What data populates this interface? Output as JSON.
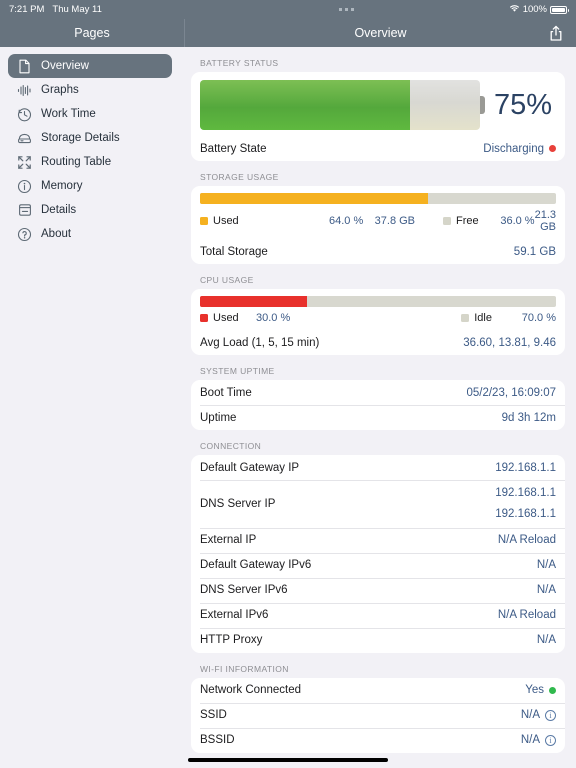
{
  "status_bar": {
    "time": "7:21 PM",
    "date": "Thu May 11",
    "wifi_icon": "wifi-icon",
    "battery_percent": "100%",
    "multitask_handle": "multitasking-handle-icon"
  },
  "nav": {
    "sidebar_title": "Pages",
    "main_title": "Overview",
    "share_icon": "share-icon"
  },
  "sidebar": {
    "items": [
      {
        "label": "Overview",
        "icon": "document-icon",
        "selected": true
      },
      {
        "label": "Graphs",
        "icon": "waveform-icon",
        "selected": false
      },
      {
        "label": "Work Time",
        "icon": "clock-arrow-icon",
        "selected": false
      },
      {
        "label": "Storage Details",
        "icon": "drive-icon",
        "selected": false
      },
      {
        "label": "Routing Table",
        "icon": "arrows-expand-icon",
        "selected": false
      },
      {
        "label": "Memory",
        "icon": "info-circle-icon",
        "selected": false
      },
      {
        "label": "Details",
        "icon": "list-box-icon",
        "selected": false
      },
      {
        "label": "About",
        "icon": "question-circle-icon",
        "selected": false
      }
    ]
  },
  "battery_status": {
    "header": "BATTERY STATUS",
    "percent_label": "75%",
    "percent_value": 75,
    "fill_color": "#54a83c",
    "state_label": "Battery State",
    "state_value": "Discharging",
    "state_dot_color": "#e8403a"
  },
  "storage_usage": {
    "header": "STORAGE USAGE",
    "used_pct_value": 64,
    "used_color": "#f5b120",
    "free_color": "#d5d5c9",
    "legend": {
      "used_label": "Used",
      "used_percent": "64.0 %",
      "used_size": "37.8 GB",
      "free_label": "Free",
      "free_percent": "36.0 %",
      "free_size": "21.3 GB"
    },
    "total_label": "Total Storage",
    "total_value": "59.1 GB"
  },
  "cpu_usage": {
    "header": "CPU USAGE",
    "used_pct_value": 30,
    "used_color": "#e8312c",
    "idle_color": "#d5d5c9",
    "legend": {
      "used_label": "Used",
      "used_percent": "30.0 %",
      "idle_label": "Idle",
      "idle_percent": "70.0 %"
    },
    "load_label": "Avg Load (1, 5, 15 min)",
    "load_value": "36.60, 13.81, 9.46"
  },
  "system_uptime": {
    "header": "SYSTEM UPTIME",
    "rows": [
      {
        "label": "Boot Time",
        "value": "05/2/23, 16:09:07"
      },
      {
        "label": "Uptime",
        "value": "9d 3h 12m"
      }
    ]
  },
  "connection": {
    "header": "CONNECTION",
    "rows": [
      {
        "label": "Default Gateway IP",
        "value": "192.168.1.1"
      },
      {
        "label": "DNS Server IP",
        "value": "192.168.1.1",
        "value2": "192.168.1.1"
      },
      {
        "label": "External IP",
        "value": "N/A Reload"
      },
      {
        "label": "Default Gateway IPv6",
        "value": "N/A"
      },
      {
        "label": "DNS Server IPv6",
        "value": "N/A"
      },
      {
        "label": "External IPv6",
        "value": "N/A Reload"
      },
      {
        "label": "HTTP Proxy",
        "value": "N/A"
      }
    ]
  },
  "wifi_information": {
    "header": "WI-FI INFORMATION",
    "rows": [
      {
        "label": "Network Connected",
        "value": "Yes",
        "dot": "green"
      },
      {
        "label": "SSID",
        "value": "N/A",
        "info": true
      },
      {
        "label": "BSSID",
        "value": "N/A",
        "info": true
      }
    ]
  }
}
